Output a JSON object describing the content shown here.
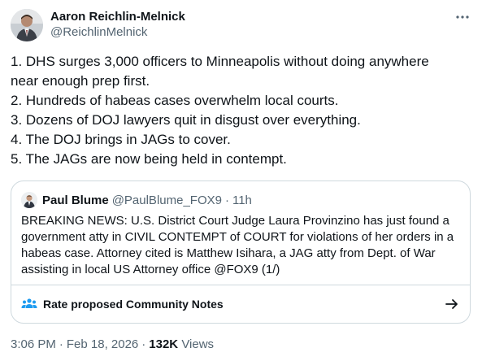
{
  "author": {
    "display_name": "Aaron Reichlin-Melnick",
    "handle": "@ReichlinMelnick"
  },
  "tweet": {
    "lines": [
      "1. DHS surges 3,000 officers to Minneapolis without doing anywhere",
      "near enough prep first.",
      "2. Hundreds of habeas cases overwhelm local courts.",
      "3. Dozens of DOJ lawyers quit in disgust over everything.",
      "4. The DOJ brings in JAGs to cover.",
      "5. The JAGs are now being held in contempt."
    ]
  },
  "quote": {
    "display_name": "Paul Blume",
    "handle": "@PaulBlume_FOX9",
    "dot": "·",
    "time": "11h",
    "lines": [
      "BREAKING NEWS: U.S. District Court Judge Laura Provinzino has just found a",
      "government atty in CIVIL CONTEMPT of COURT for violations of her orders in a",
      "habeas case. Attorney cited is Matthew Isihara, a JAG atty from Dept. of War",
      "assisting in local US Attorney office @FOX9 (1/)"
    ],
    "community_notes_label": "Rate proposed Community Notes"
  },
  "meta": {
    "time": "3:06 PM",
    "date": "Feb 18, 2026",
    "sep": "·",
    "views_count": "132K",
    "views_label": "Views"
  },
  "icons": {
    "more": "more-dots-icon",
    "community_notes": "people-icon",
    "arrow": "arrow-right-icon"
  },
  "colors": {
    "text_primary": "#0f1419",
    "text_secondary": "#536471",
    "border": "#cfd9de",
    "accent": "#1d9bf0"
  }
}
